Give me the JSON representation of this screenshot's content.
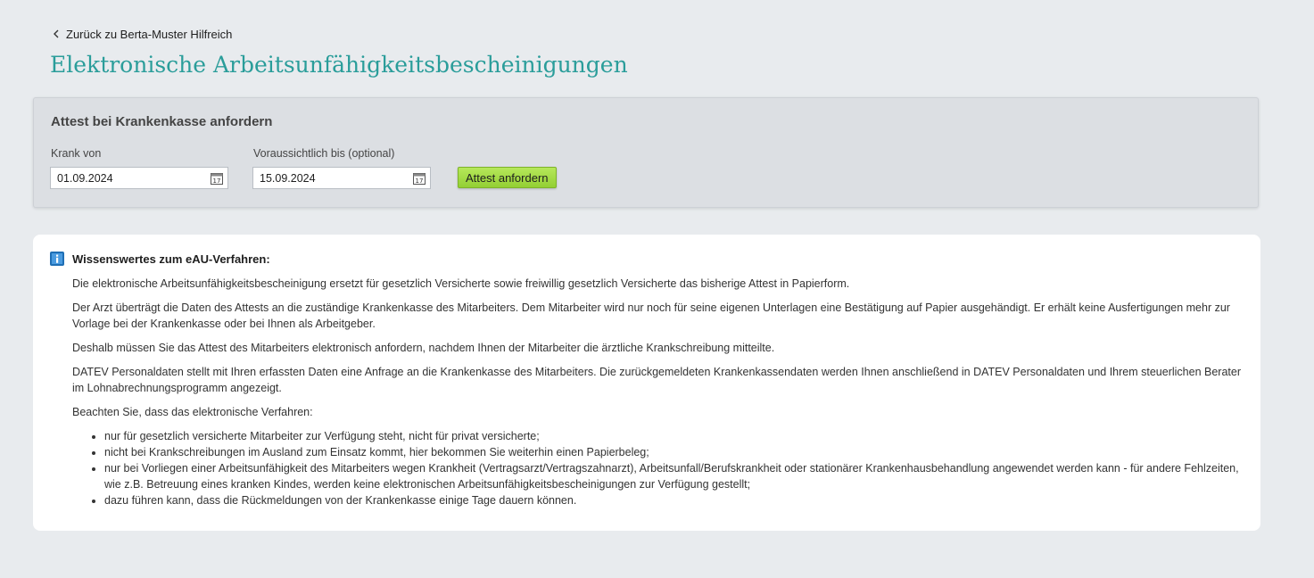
{
  "nav": {
    "back_label": "Zurück zu Berta-Muster Hilfreich"
  },
  "page": {
    "title": "Elektronische Arbeitsunfähigkeitsbescheinigungen"
  },
  "request_form": {
    "title": "Attest bei Krankenkasse anfordern",
    "sick_from_label": "Krank von",
    "sick_from_value": "01.09.2024",
    "expected_until_label": "Voraussichtlich bis (optional)",
    "expected_until_value": "15.09.2024",
    "submit_label": "Attest anfordern",
    "calendar_icon": "calendar-icon"
  },
  "info": {
    "icon": "info-icon",
    "heading": "Wissenswertes zum eAU-Verfahren:",
    "paragraphs": [
      "Die elektronische Arbeitsunfähigkeitsbescheinigung ersetzt für gesetzlich Versicherte sowie freiwillig gesetzlich Versicherte das bisherige Attest in Papierform.",
      "Der Arzt überträgt die Daten des Attests an die zuständige Krankenkasse des Mitarbeiters. Dem Mitarbeiter wird nur noch für seine eigenen Unterlagen eine Bestätigung auf Papier ausgehändigt. Er erhält keine Ausfertigungen mehr zur Vorlage bei der Krankenkasse oder bei Ihnen als Arbeitgeber.",
      "Deshalb müssen Sie das Attest des Mitarbeiters elektronisch anfordern, nachdem Ihnen der Mitarbeiter die ärztliche Krankschreibung mitteilte.",
      "DATEV Personaldaten stellt mit Ihren erfassten Daten eine Anfrage an die Krankenkasse des Mitarbeiters. Die zurückgemeldeten Krankenkassendaten werden Ihnen anschließend in DATEV Personaldaten und Ihrem steuerlichen Berater im Lohnabrechnungsprogramm angezeigt.",
      "Beachten Sie, dass das elektronische Verfahren:"
    ],
    "bullets": [
      "nur für gesetzlich versicherte Mitarbeiter zur Verfügung steht, nicht für privat versicherte;",
      "nicht bei Krankschreibungen im Ausland zum Einsatz kommt, hier bekommen Sie weiterhin einen Papierbeleg;",
      "nur bei Vorliegen einer Arbeitsunfähigkeit des Mitarbeiters wegen Krankheit (Vertragsarzt/Vertragszahnarzt), Arbeitsunfall/Berufskrankheit oder stationärer Krankenhausbehandlung angewendet werden kann - für andere Fehlzeiten, wie z.B. Betreuung eines kranken Kindes, werden keine elektronischen Arbeitsunfähigkeitsbescheinigungen zur Verfügung gestellt;",
      "dazu führen kann, dass die Rückmeldungen von der Krankenkasse einige Tage dauern können."
    ]
  },
  "colors": {
    "title_teal": "#2a9d9a",
    "button_green": "#9ed93f",
    "page_background": "#e8ebee",
    "info_icon_blue": "#1f6fb5"
  }
}
